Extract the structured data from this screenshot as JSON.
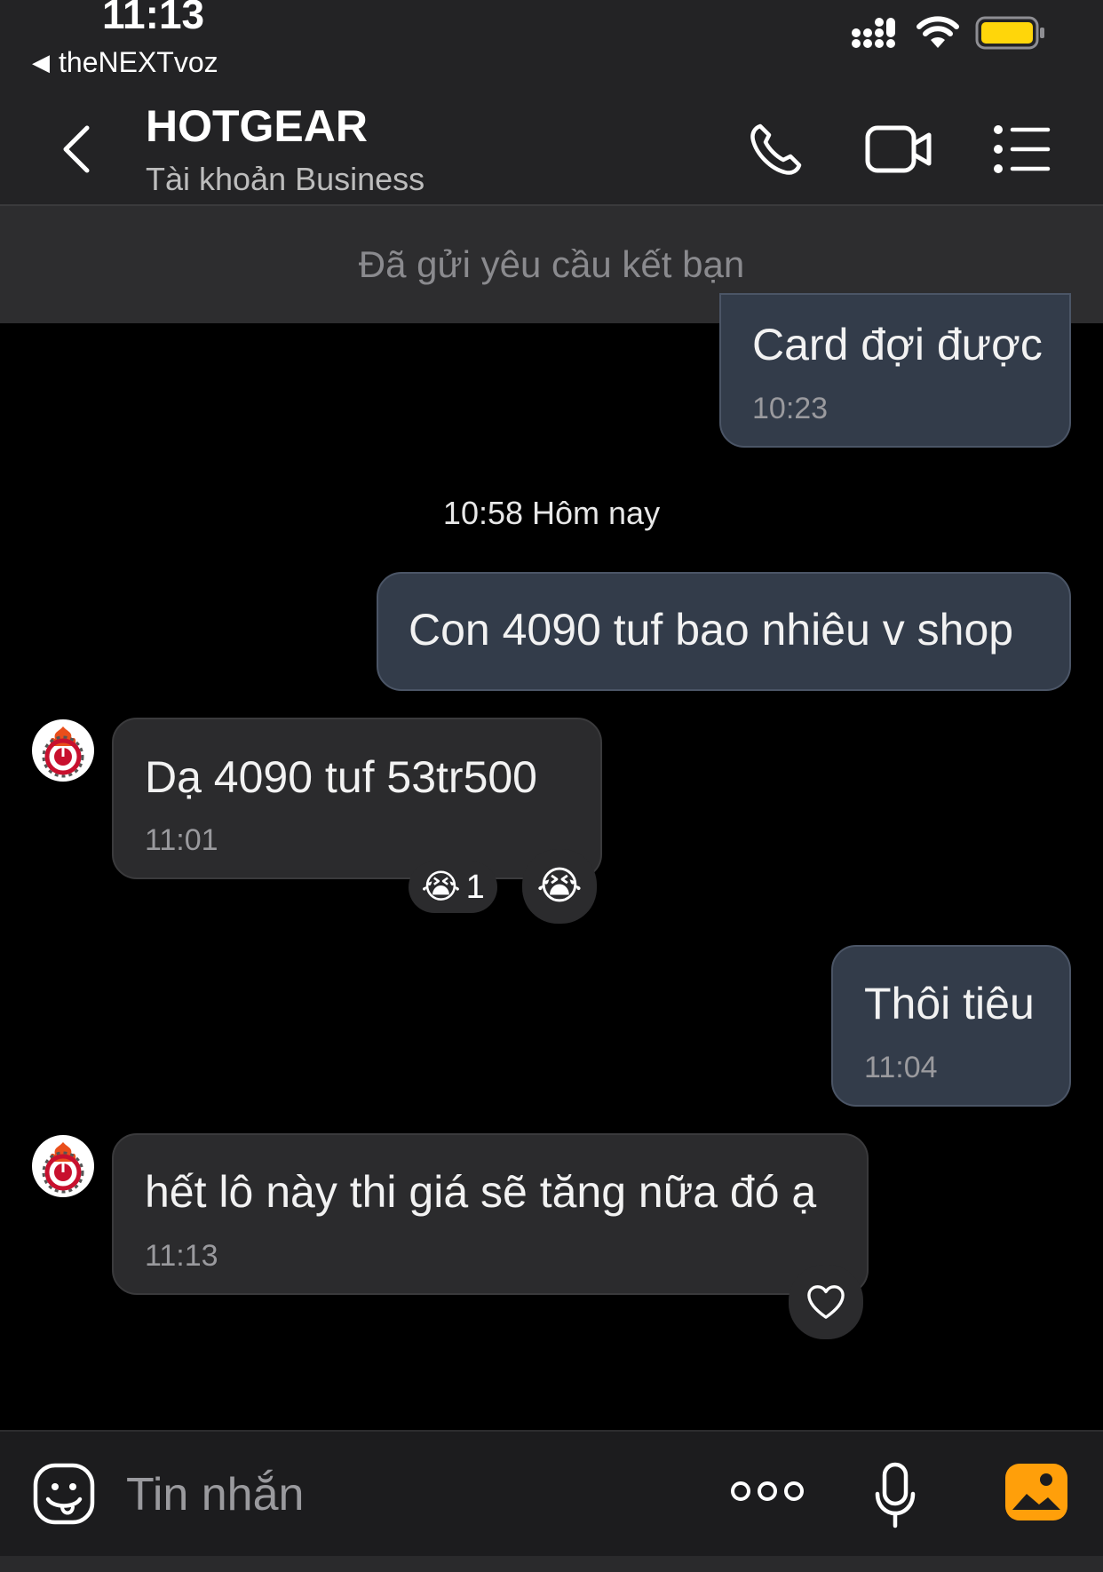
{
  "status_bar": {
    "time": "11:13",
    "back_app": "theNEXTvoz",
    "back_arrow_icon": "back-triangle-icon",
    "battery_color": "#ffd60a"
  },
  "header": {
    "title": "HOTGEAR",
    "subtitle": "Tài khoản Business",
    "icons": [
      "phone-icon",
      "video-camera-icon",
      "menu-list-icon"
    ]
  },
  "friend_request": {
    "text": "Đã gửi yêu cầu kết bạn"
  },
  "conversation": {
    "date_divider": "10:58 Hôm nay",
    "messages": [
      {
        "side": "out",
        "text": "Card đợi được",
        "time": "10:23"
      },
      {
        "side": "out",
        "text": "Con 4090 tuf bao nhiêu v shop",
        "time": ""
      },
      {
        "side": "in",
        "text": "Dạ 4090 tuf 53tr500",
        "time": "11:01",
        "reaction_count": "1",
        "reaction_emoji": "😭"
      },
      {
        "side": "out",
        "text": "Thôi tiêu",
        "time": "11:04"
      },
      {
        "side": "in",
        "text": "hết lô này  thi giá sẽ tăng nữa đó ạ",
        "time": "11:13"
      }
    ]
  },
  "composer": {
    "placeholder": "Tin nhắn",
    "icons": [
      "emoji-icon",
      "more-icon",
      "microphone-icon",
      "image-icon"
    ],
    "image_icon_color": "#ff9f0a"
  }
}
